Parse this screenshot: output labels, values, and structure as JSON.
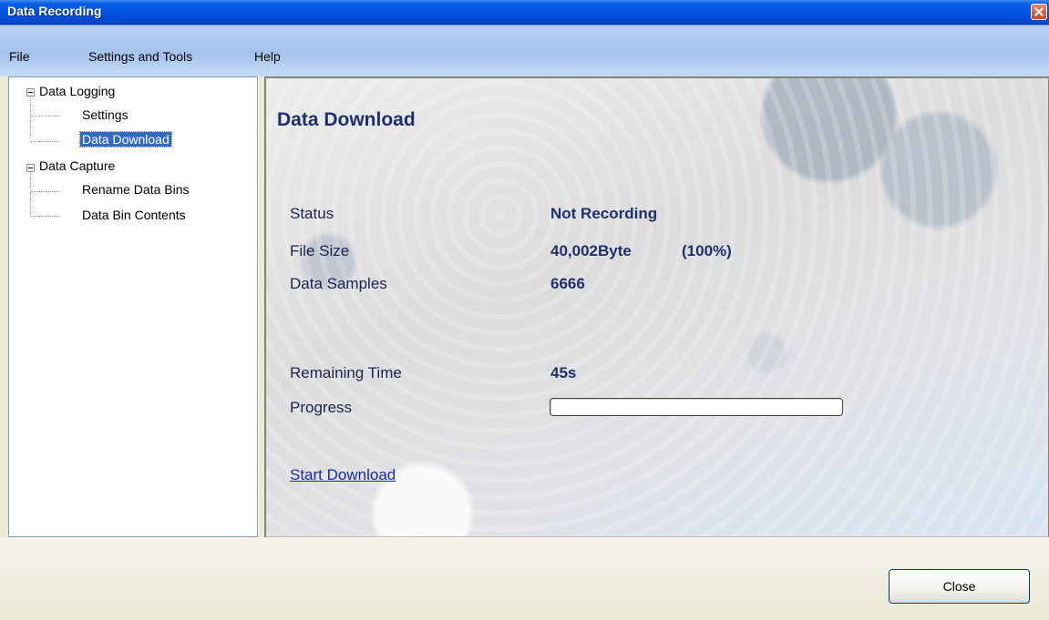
{
  "window": {
    "title": "Data Recording"
  },
  "menubar": {
    "items": [
      "File",
      "Settings and Tools",
      "Help"
    ]
  },
  "tree": {
    "groups": [
      {
        "label": "Data Logging",
        "children": [
          "Settings",
          "Data Download"
        ]
      },
      {
        "label": "Data Capture",
        "children": [
          "Rename Data Bins",
          "Data Bin Contents"
        ]
      }
    ],
    "selected": "Data Download"
  },
  "content": {
    "heading": "Data Download",
    "status": {
      "label": "Status",
      "value": "Not Recording"
    },
    "file_size": {
      "label": "File Size",
      "value": "40,002Byte",
      "percent": "(100%)"
    },
    "data_samples": {
      "label": "Data Samples",
      "value": "6666"
    },
    "remaining_time": {
      "label": "Remaining Time",
      "value": "45s"
    },
    "progress": {
      "label": "Progress",
      "fraction": 0
    },
    "start_link": "Start Download"
  },
  "footer": {
    "close_label": "Close"
  },
  "colors": {
    "title_bar": "#0054e3",
    "menubar": "#a5c3ee",
    "heading": "#1f2f6e",
    "link": "#1b2aa8",
    "selection": "#316ac5"
  },
  "icons": {
    "window_close": "close-icon",
    "tree_expander": "minus-box-icon"
  }
}
